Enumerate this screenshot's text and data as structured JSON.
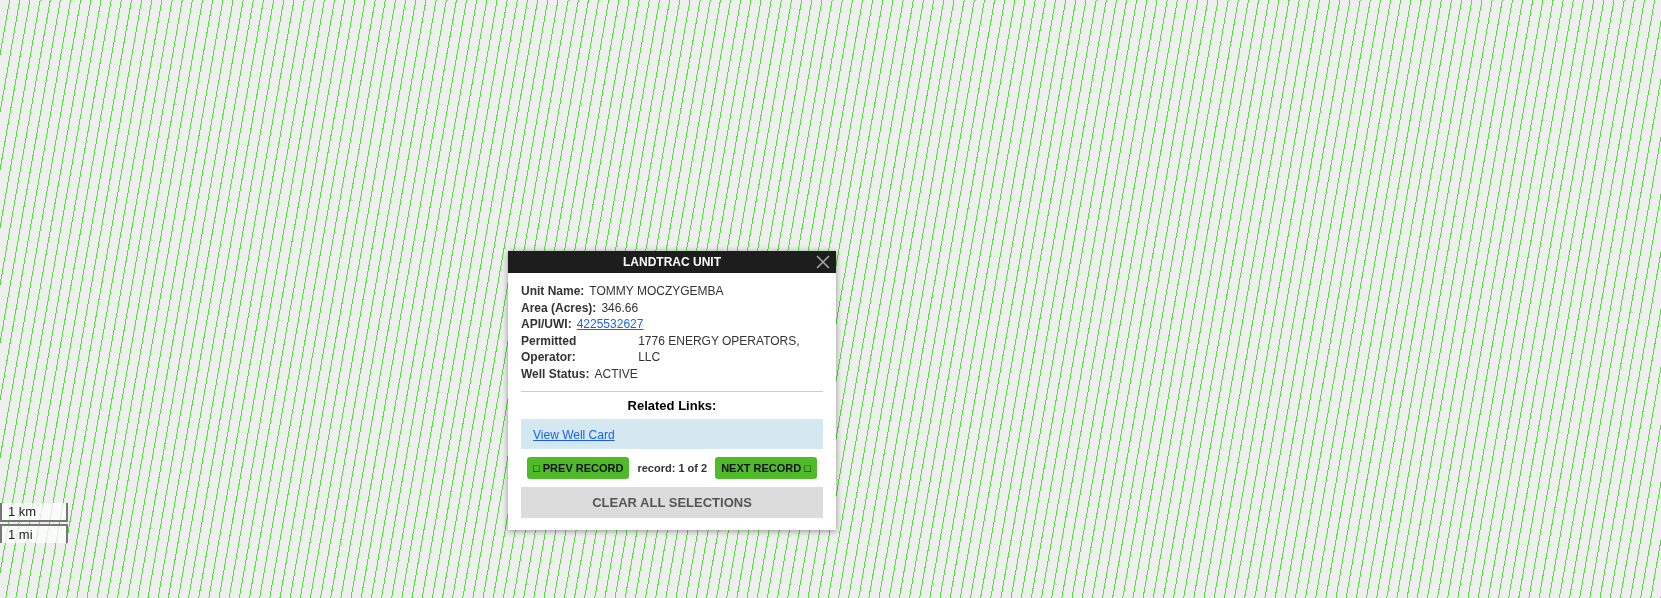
{
  "popup": {
    "title": "LANDTRAC UNIT",
    "fields": [
      {
        "label": "Unit Name:",
        "value": "TOMMY MOCZYGEMBA",
        "kind": "text"
      },
      {
        "label": "Area (Acres):",
        "value": "346.66",
        "kind": "text"
      },
      {
        "label": "API/UWI:",
        "value": "4225532627",
        "kind": "link"
      },
      {
        "label": "Permitted Operator:",
        "value": "1776 ENERGY OPERATORS, LLC",
        "kind": "text"
      },
      {
        "label": "Well Status:",
        "value": "ACTIVE",
        "kind": "text"
      }
    ],
    "related_heading": "Related Links:",
    "links": [
      "View Well Card"
    ],
    "prev_button": "□ PREV RECORD",
    "record_counter": "record: 1 of 2",
    "next_button": "NEXT RECORD □",
    "clear_button": "CLEAR ALL SELECTIONS"
  },
  "scale": {
    "metric": "1 km",
    "imperial": "1 mi"
  }
}
